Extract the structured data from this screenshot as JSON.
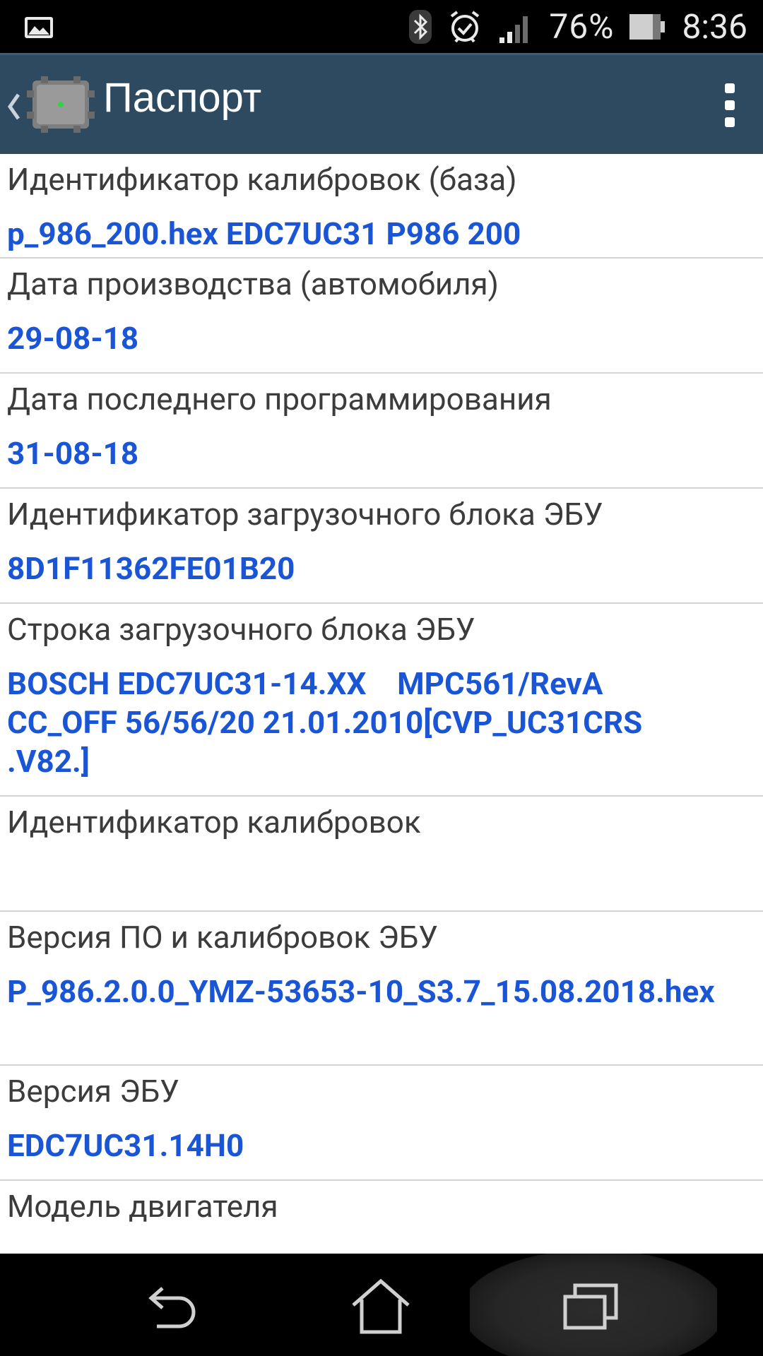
{
  "status_bar": {
    "battery_percent": "76%",
    "time": "8:36",
    "icons": [
      "image-notification-icon",
      "bluetooth-icon",
      "alarm-icon",
      "signal-icon",
      "battery-icon"
    ]
  },
  "action_bar": {
    "title": "Паспорт"
  },
  "items": [
    {
      "label": "Идентификатор калибровок (база)",
      "value": "p_986_200.hex EDC7UC31 P986 200"
    },
    {
      "label": "Дата производства (автомобиля)",
      "value": "29-08-18"
    },
    {
      "label": "Дата последнего программирования",
      "value": "31-08-18"
    },
    {
      "label": "Идентификатор загрузочного блока ЭБУ",
      "value": "8D1F11362FE01B20"
    },
    {
      "label": "Строка загрузочного блока ЭБУ",
      "value": "BOSCH EDC7UC31-14.XX    MPC561/RevA\nCC_OFF 56/56/20 21.01.2010[CVP_UC31CRS\n.V82.]"
    },
    {
      "label": "Идентификатор калибровок",
      "value": ""
    },
    {
      "label": "Версия ПО и калибровок ЭБУ",
      "value": "P_986.2.0.0_YMZ-53653-10_S3.7_15.08.2018.hex"
    },
    {
      "label": "Версия ЭБУ",
      "value": "EDC7UC31.14H0"
    },
    {
      "label": "Модель двигателя",
      "value": ""
    }
  ],
  "colors": {
    "action_bar": "#2d4a60",
    "value_text": "#1a55d6",
    "label_text": "#3c3c3c"
  }
}
